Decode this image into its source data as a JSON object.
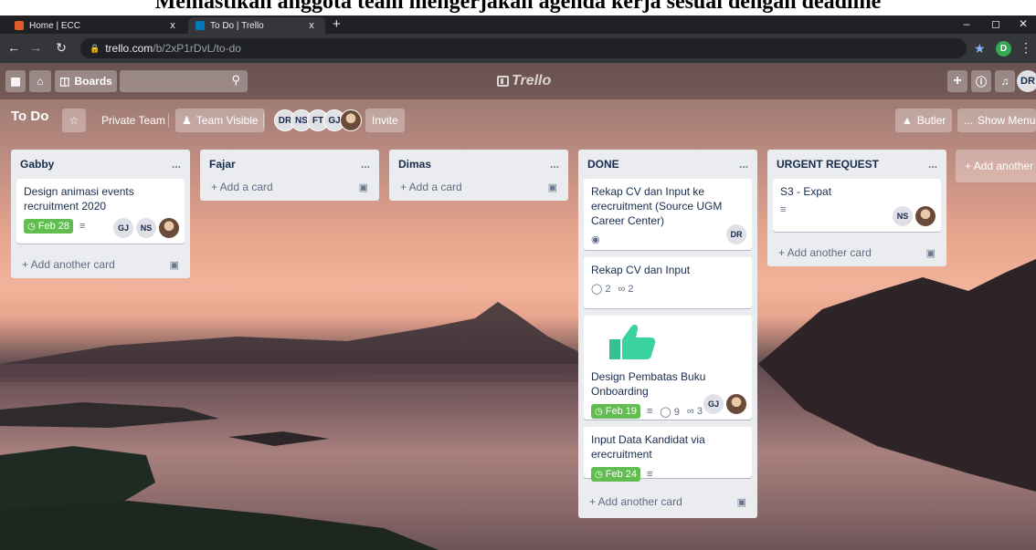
{
  "caption": "Memastikan anggota team mengerjakan agenda kerja sesuai  dengan deadline",
  "browser": {
    "tabs": [
      {
        "title": "Home | ECC",
        "active": false
      },
      {
        "title": "To Do | Trello",
        "active": true
      }
    ],
    "new_tab": "+",
    "close": "x",
    "url_host": "trello.com",
    "url_path": "/b/2xP1rDvL/to-do",
    "profile_initial": "D"
  },
  "topnav": {
    "boards_label": "Boards",
    "logo_text": "Trello",
    "my_initials": "DR"
  },
  "board": {
    "title": "To Do",
    "team": "Private Team",
    "visibility": "Team Visible",
    "members": [
      "DR",
      "NS",
      "FT",
      "GJ"
    ],
    "invite": "Invite",
    "butler": "Butler",
    "show_menu": "Show Menu"
  },
  "lists": [
    {
      "title": "Gabby",
      "cards": [
        {
          "title": "Design animasi events recruitment 2020",
          "due": "Feb 28",
          "members": [
            "GJ",
            "NS"
          ]
        }
      ],
      "add": "+ Add another card"
    },
    {
      "title": "Fajar",
      "add": "+ Add a card"
    },
    {
      "title": "Dimas",
      "add": "+ Add a card"
    },
    {
      "title": "DONE",
      "cards": [
        {
          "title": "Rekap CV dan Input ke erecruitment (Source UGM Career Center)",
          "members": [
            "DR"
          ]
        },
        {
          "title": "Rekap CV dan Input",
          "comments": "2",
          "attachments": "2"
        },
        {
          "title": "Design Pembatas Buku Onboarding",
          "due": "Feb 19",
          "comments": "9",
          "attachments": "3",
          "members": [
            "GJ"
          ]
        },
        {
          "title": "Input Data Kandidat via erecruitment",
          "due": "Feb 24"
        }
      ],
      "add": "+ Add another card"
    },
    {
      "title": "URGENT REQUEST",
      "cards": [
        {
          "title": "S3 - Expat",
          "members": [
            "NS"
          ]
        }
      ],
      "add": "+ Add another card"
    }
  ],
  "add_list": "+ Add another list",
  "menu_dots": "...",
  "icons": {
    "more": "ellipsis-icon",
    "template": "card-template-icon",
    "description": "description-icon",
    "comment": "comment-icon",
    "attachment": "attachment-icon",
    "clock": "clock-icon"
  }
}
